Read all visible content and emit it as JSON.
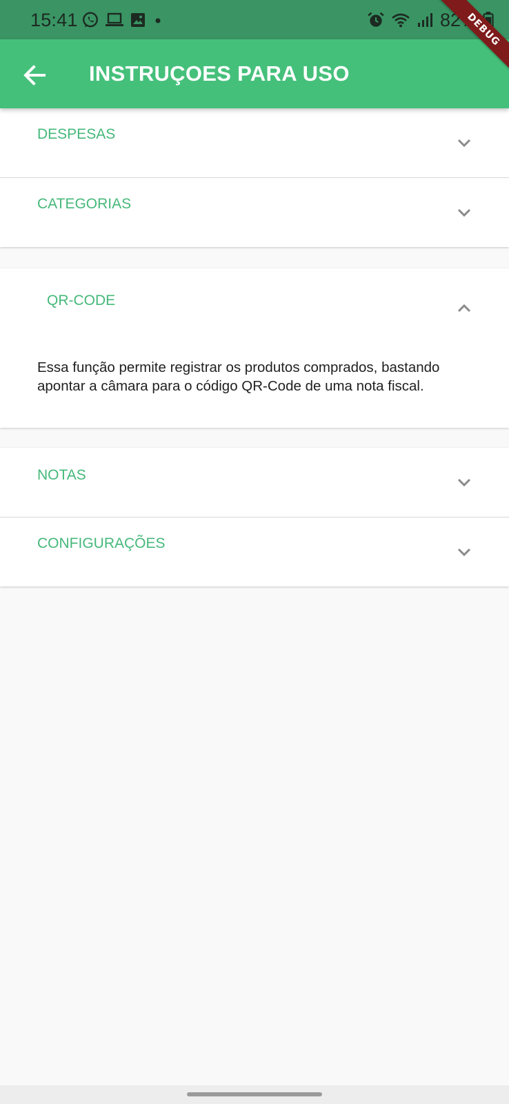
{
  "status_bar": {
    "time": "15:41",
    "battery": "82%",
    "icons_left": [
      "whatsapp-icon",
      "laptop-icon",
      "image-icon",
      "dot-icon"
    ],
    "icons_right": [
      "alarm-icon",
      "wifi-icon",
      "signal-icon",
      "battery-icon"
    ]
  },
  "debug_banner": "DEBUG",
  "app_bar": {
    "title": "INSTRUÇOES PARA USO",
    "back_icon": "arrow-back-icon",
    "background": "#45c07b"
  },
  "colors": {
    "accent": "#45b87a",
    "status_bar": "#3a9464",
    "page_background": "#f9f9f9",
    "body_text": "#1f1f1f",
    "chevron": "#8a8a8a"
  },
  "sections": [
    {
      "title": "DESPESAS",
      "expanded": false,
      "icon": "chevron-down-icon"
    },
    {
      "title": "CATEGORIAS",
      "expanded": false,
      "icon": "chevron-down-icon"
    },
    {
      "title": "QR-CODE",
      "expanded": true,
      "icon": "chevron-up-icon",
      "body": "Essa função permite registrar os produtos comprados, bastando apontar a câmara para o código QR-Code de uma nota fiscal."
    },
    {
      "title": "NOTAS",
      "expanded": false,
      "icon": "chevron-down-icon"
    },
    {
      "title": "CONFIGURAÇÕES",
      "expanded": false,
      "icon": "chevron-down-icon"
    }
  ]
}
